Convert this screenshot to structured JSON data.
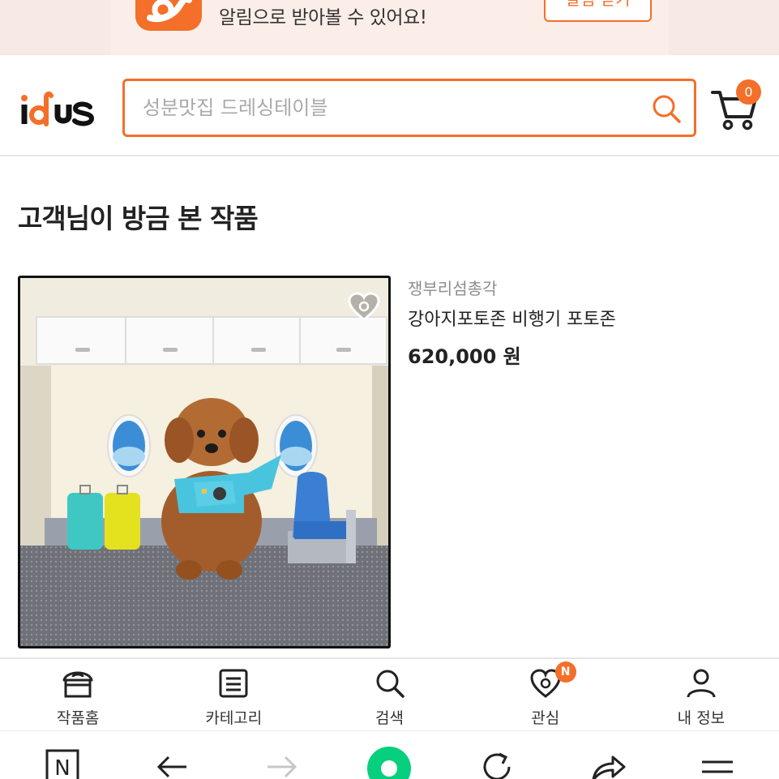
{
  "banner": {
    "message": "알림으로 받아볼 수 있어요!",
    "button_label": "알림 받기",
    "icon": "idus-app-icon"
  },
  "header": {
    "logo": "idus",
    "search": {
      "placeholder": "성분맛집 드레싱테이블",
      "icon": "search-icon"
    },
    "cart": {
      "count": "0",
      "icon": "cart-icon"
    }
  },
  "section": {
    "title": "고객님이 방금 본 작품"
  },
  "product": {
    "seller": "쟁부리섬총각",
    "name": "강아지포토존 비행기 포토존",
    "price": "620,000 원",
    "image": "poodle-in-airplane-photozone",
    "heart_icon": "heart-icon"
  },
  "tabbar": {
    "items": [
      {
        "label": "작품홈",
        "icon": "shop-home-icon"
      },
      {
        "label": "카테고리",
        "icon": "list-icon"
      },
      {
        "label": "검색",
        "icon": "search-icon"
      },
      {
        "label": "관심",
        "icon": "heart-icon",
        "badge": "N"
      },
      {
        "label": "내 정보",
        "icon": "user-icon"
      }
    ]
  },
  "browser": {
    "home_badge": "N",
    "icons": [
      "naver-home-icon",
      "back-icon",
      "forward-icon",
      "green-dot-icon",
      "refresh-icon",
      "share-icon",
      "menu-icon"
    ]
  },
  "colors": {
    "accent": "#f46f29",
    "banner_bg": "#fbeee8",
    "text": "#222222",
    "muted": "#8c8c8c"
  }
}
